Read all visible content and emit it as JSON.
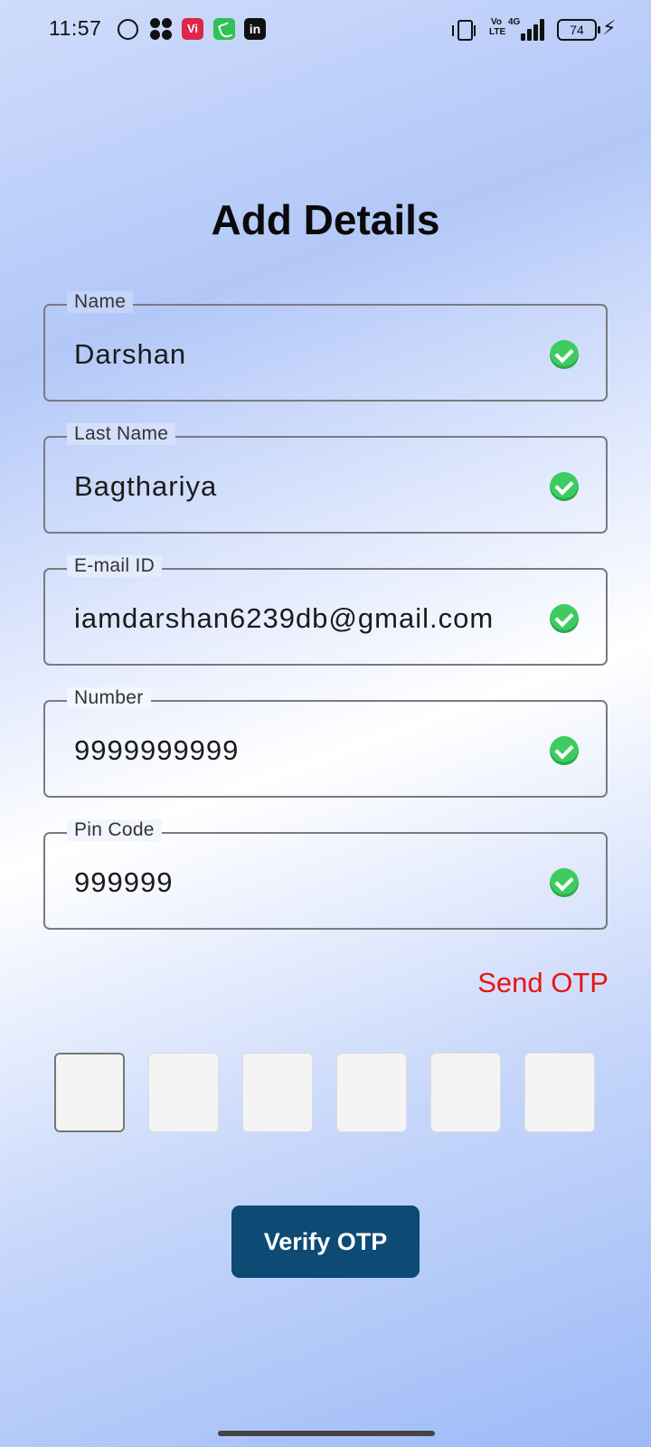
{
  "status_bar": {
    "time": "11:57",
    "icons": [
      "whatsapp-icon",
      "clover-icon",
      "vi-app-icon",
      "phone-icon",
      "linkedin-icon"
    ],
    "vi_label": "Vi",
    "linkedin_label": "in",
    "volte_label": "Vo LTE",
    "network_label": "4G",
    "battery_level": "74"
  },
  "page": {
    "title": "Add Details"
  },
  "form": {
    "fields": [
      {
        "label": "Name",
        "value": "Darshan",
        "valid": true
      },
      {
        "label": "Last Name",
        "value": "Bagthariya",
        "valid": true
      },
      {
        "label": "E-mail ID",
        "value": "iamdarshan6239db@gmail.com",
        "valid": true
      },
      {
        "label": "Number",
        "value": "9999999999",
        "valid": true
      },
      {
        "label": "Pin Code",
        "value": "999999",
        "valid": true
      }
    ],
    "send_otp_label": "Send OTP",
    "otp_digits": [
      "",
      "",
      "",
      "",
      "",
      ""
    ],
    "verify_label": "Verify OTP"
  },
  "colors": {
    "accent_button": "#0d4a74",
    "send_otp": "#e81414",
    "valid_check": "#3ecb61"
  }
}
